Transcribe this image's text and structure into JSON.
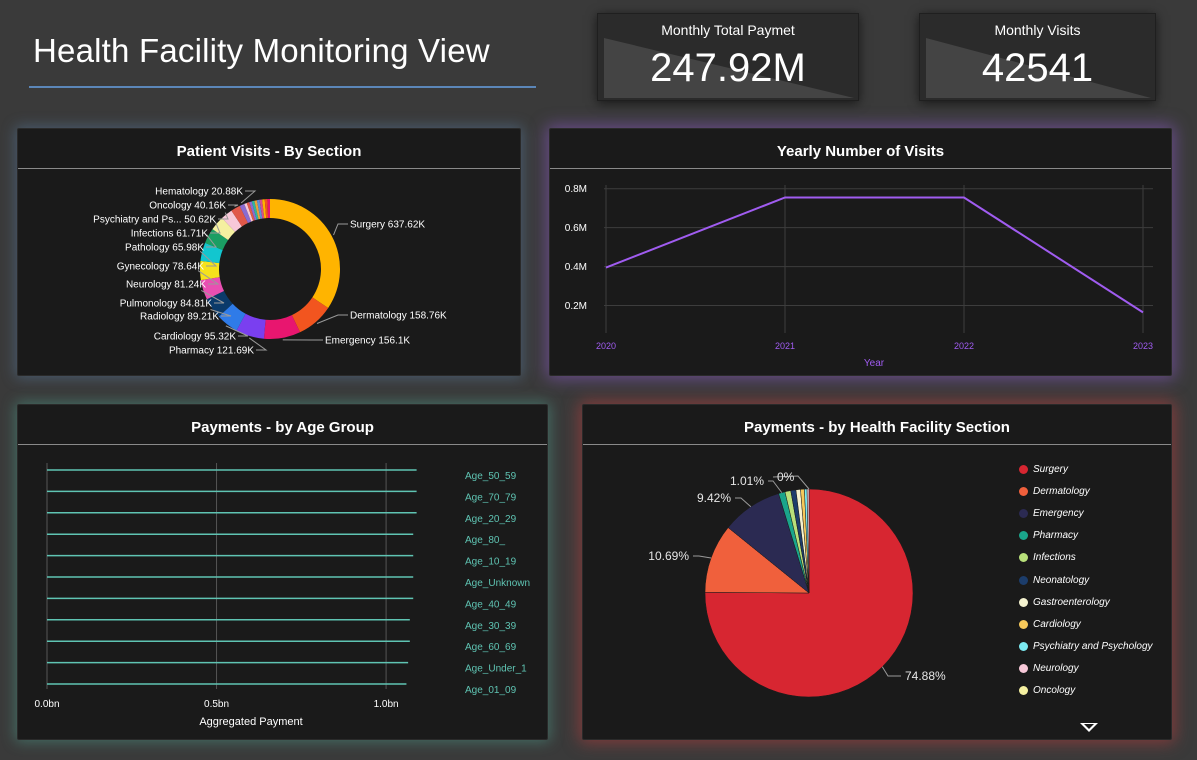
{
  "header": {
    "title": "Health Facility Monitoring View"
  },
  "kpis": [
    {
      "label": "Monthly Total Paymet",
      "value": "247.92M"
    },
    {
      "label": "Monthly Visits",
      "value": "42541"
    }
  ],
  "colors": {
    "surgery": "#ffb400",
    "dermatology": "#f2551f",
    "emergency": "#e8166f",
    "pharmacy": "#7a3ff0",
    "cardiology": "#2f7be8",
    "radiology": "#0b3a6a",
    "pulmonology": "#e94fb2",
    "neurology": "#f6e21b",
    "gynecology": "#12c6cf",
    "pathology": "#1b9e63",
    "infections": "#f5f0a0",
    "line": "#a05cf0",
    "axis_purple": "#a05cf0",
    "age_label": "#5fc4b3",
    "age_line": "#5fc4b3",
    "pie_surgery": "#d72631",
    "pie_dermatology": "#f0603c",
    "pie_emergency": "#2b2a52",
    "pie_pharmacy": "#1aa58b",
    "pie_infections": "#b8e07a",
    "pie_neonatology": "#1c3d6b",
    "pie_gastro": "#f4f2cf",
    "pie_cardiology": "#f7c95a",
    "pie_psych": "#7be9f0",
    "pie_neurology": "#f7c8d8",
    "pie_oncology": "#f5f0a0"
  },
  "chart_data": [
    {
      "type": "pie",
      "title": "Patient Visits - By Section",
      "donut": true,
      "categories": [
        "Surgery",
        "Dermatology",
        "Emergency",
        "Pharmacy",
        "Cardiology",
        "Radiology",
        "Pulmonology",
        "Neurology",
        "Gynecology",
        "Pathology",
        "Infections",
        "Psychiatry and Ps...",
        "Oncology",
        "Hematology"
      ],
      "values": [
        637620,
        158760,
        156100,
        121690,
        95320,
        89210,
        84810,
        81240,
        78640,
        65980,
        61710,
        50620,
        40160,
        20880
      ],
      "data_labels": [
        "Surgery 637.62K",
        "Dermatology 158.76K",
        "Emergency 156.1K",
        "Pharmacy 121.69K",
        "Cardiology 95.32K",
        "Radiology 89.21K",
        "Pulmonology 84.81K",
        "Neurology 81.24K",
        "Gynecology 78.64K",
        "Pathology 65.98K",
        "Infections 61.71K",
        "Psychiatry and Ps... 50.62K",
        "Oncology 40.16K",
        "Hematology 20.88K"
      ]
    },
    {
      "type": "line",
      "title": "Yearly Number of Visits",
      "x": [
        2020,
        2021,
        2022,
        2023
      ],
      "values": [
        395000,
        755000,
        755000,
        165000
      ],
      "xlabel": "Year",
      "ylabel": "",
      "xticks": [
        "2020",
        "2021",
        "2022",
        "2023"
      ],
      "yticks": [
        "0.2M",
        "0.4M",
        "0.6M",
        "0.8M"
      ],
      "ytick_values": [
        200000,
        400000,
        600000,
        800000
      ],
      "ylim": [
        100000,
        850000
      ],
      "grid": true
    },
    {
      "type": "bar",
      "orientation": "horizontal",
      "title": "Payments - by Age Group",
      "categories": [
        "Age_50_59",
        "Age_70_79",
        "Age_20_29",
        "Age_80_",
        "Age_10_19",
        "Age_Unknown",
        "Age_40_49",
        "Age_30_39",
        "Age_60_69",
        "Age_Under_1",
        "Age_01_09"
      ],
      "values": [
        1090000000,
        1090000000,
        1090000000,
        1080000000,
        1080000000,
        1080000000,
        1080000000,
        1070000000,
        1070000000,
        1065000000,
        1060000000
      ],
      "xlabel": "Aggregated Payment",
      "xticks": [
        "0.0bn",
        "0.5bn",
        "1.0bn"
      ],
      "xtick_values": [
        0,
        500000000,
        1000000000
      ],
      "xlim": [
        0,
        1100000000
      ]
    },
    {
      "type": "pie",
      "title": "Payments - by Health Facility Section",
      "categories": [
        "Surgery",
        "Dermatology",
        "Emergency",
        "Pharmacy",
        "Infections",
        "Neonatology",
        "Gastroenterology",
        "Cardiology",
        "Psychiatry and Psychology",
        "Neurology",
        "Oncology"
      ],
      "values": [
        74.88,
        10.69,
        9.42,
        1.01,
        0.9,
        0.8,
        0.7,
        0.6,
        0.4,
        0.3,
        0.0
      ],
      "data_labels": [
        "74.88%",
        "10.69%",
        "9.42%",
        "1.01%",
        "0%"
      ],
      "legend": "right"
    }
  ]
}
